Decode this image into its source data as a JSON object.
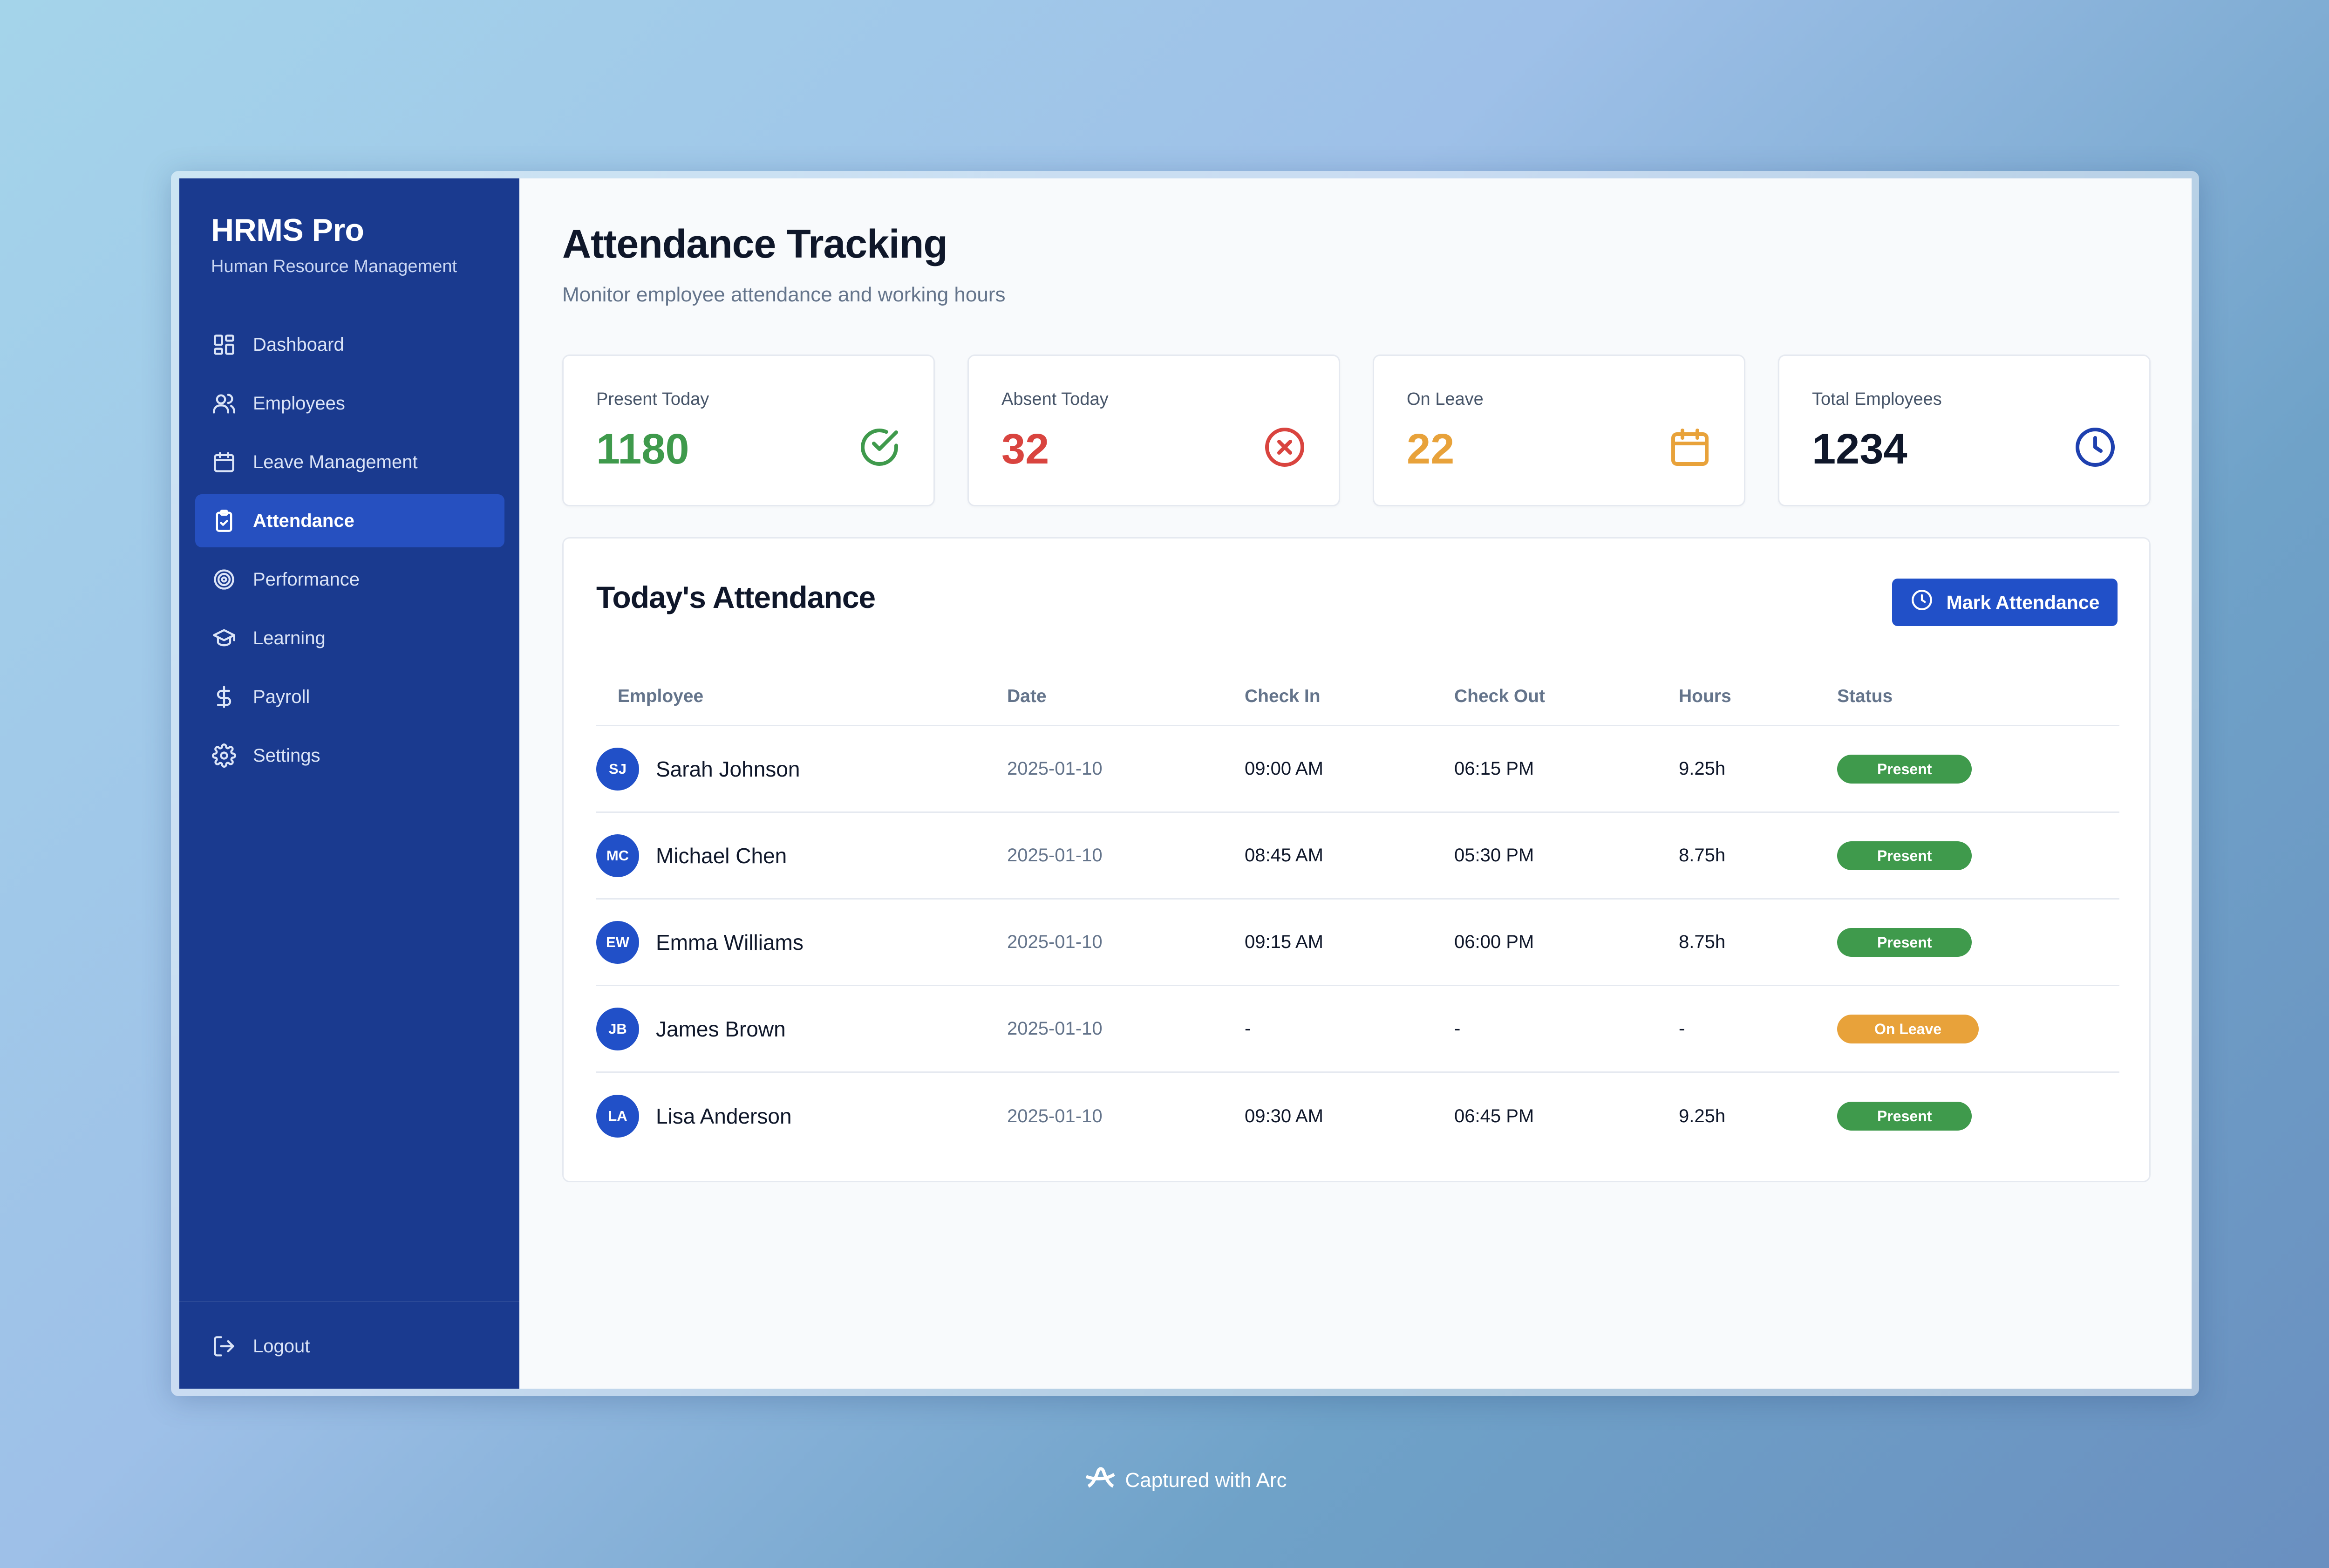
{
  "sidebar": {
    "brand_title": "HRMS Pro",
    "brand_subtitle": "Human Resource Management",
    "items": [
      {
        "label": "Dashboard",
        "icon": "dashboard-icon"
      },
      {
        "label": "Employees",
        "icon": "users-icon"
      },
      {
        "label": "Leave Management",
        "icon": "calendar-icon"
      },
      {
        "label": "Attendance",
        "icon": "clipboard-check-icon",
        "active": true
      },
      {
        "label": "Performance",
        "icon": "target-icon"
      },
      {
        "label": "Learning",
        "icon": "graduation-cap-icon"
      },
      {
        "label": "Payroll",
        "icon": "dollar-icon"
      },
      {
        "label": "Settings",
        "icon": "gear-icon"
      }
    ],
    "logout_label": "Logout"
  },
  "header": {
    "title": "Attendance Tracking",
    "subtitle": "Monitor employee attendance and working hours"
  },
  "stats": [
    {
      "label": "Present Today",
      "value": "1180",
      "color": "#3f9a4c",
      "icon": "check-circle-icon"
    },
    {
      "label": "Absent Today",
      "value": "32",
      "color": "#d9443f",
      "icon": "x-circle-icon"
    },
    {
      "label": "On Leave",
      "value": "22",
      "color": "#e8a23a",
      "icon": "calendar-icon"
    },
    {
      "label": "Total Employees",
      "value": "1234",
      "color": "#0f172a",
      "icon": "clock-icon"
    }
  ],
  "panel": {
    "title": "Today's Attendance",
    "mark_button_label": "Mark Attendance"
  },
  "table": {
    "headers": [
      "Employee",
      "Date",
      "Check In",
      "Check Out",
      "Hours",
      "Status"
    ],
    "rows": [
      {
        "initials": "SJ",
        "name": "Sarah Johnson",
        "date": "2025-01-10",
        "check_in": "09:00 AM",
        "check_out": "06:15 PM",
        "hours": "9.25h",
        "status": "Present"
      },
      {
        "initials": "MC",
        "name": "Michael Chen",
        "date": "2025-01-10",
        "check_in": "08:45 AM",
        "check_out": "05:30 PM",
        "hours": "8.75h",
        "status": "Present"
      },
      {
        "initials": "EW",
        "name": "Emma Williams",
        "date": "2025-01-10",
        "check_in": "09:15 AM",
        "check_out": "06:00 PM",
        "hours": "8.75h",
        "status": "Present"
      },
      {
        "initials": "JB",
        "name": "James Brown",
        "date": "2025-01-10",
        "check_in": "-",
        "check_out": "-",
        "hours": "-",
        "status": "On Leave"
      },
      {
        "initials": "LA",
        "name": "Lisa Anderson",
        "date": "2025-01-10",
        "check_in": "09:30 AM",
        "check_out": "06:45 PM",
        "hours": "9.25h",
        "status": "Present"
      }
    ]
  },
  "colors": {
    "sidebar_bg": "#1a3a8f",
    "active_nav": "#2650c0",
    "accent": "#2150c8",
    "present_badge": "#3f9a4c",
    "leave_badge": "#e8a23a"
  },
  "footer": {
    "text": "Captured with Arc"
  }
}
